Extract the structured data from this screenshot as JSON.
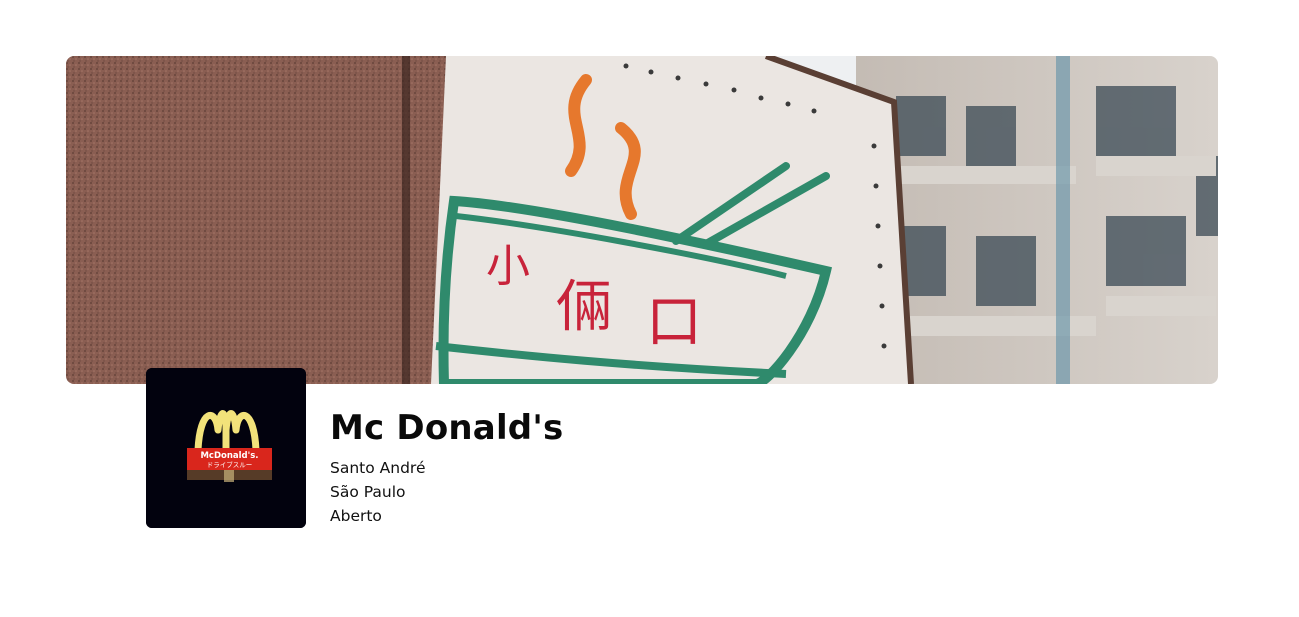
{
  "store": {
    "name": "Mc Donald's",
    "city": "Santo André",
    "state": "São Paulo",
    "status": "Aberto"
  },
  "banner": {
    "image": "noodle-bowl-neon-sign-photo",
    "sign_text": "小倆口"
  },
  "logo": {
    "image": "mcdonalds-golden-arches-logo",
    "sign_text": "McDonald's",
    "sign_subtext": "ドライブスルー",
    "colors": {
      "background": "#02020e",
      "arches": "#f2e27a",
      "sign": "#d9261c"
    }
  }
}
